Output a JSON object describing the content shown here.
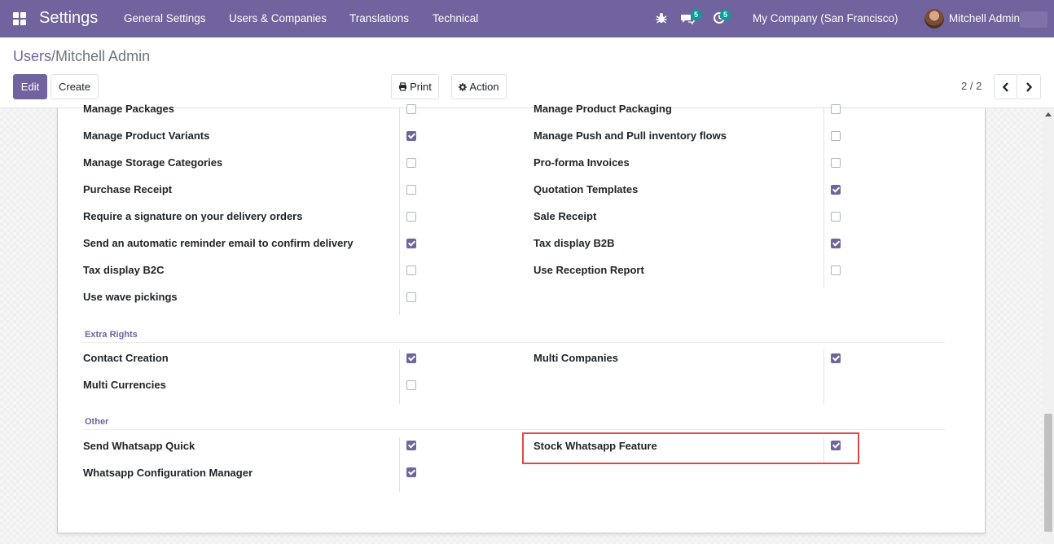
{
  "navbar": {
    "brand": "Settings",
    "menu": [
      "General Settings",
      "Users & Companies",
      "Translations",
      "Technical"
    ],
    "messages_count": "5",
    "activities_count": "5",
    "company": "My Company (San Francisco)",
    "user": "Mitchell Admin"
  },
  "breadcrumb": {
    "parent": "Users",
    "separator": "/",
    "current": "Mitchell Admin"
  },
  "buttons": {
    "edit": "Edit",
    "create": "Create",
    "print": "Print",
    "action": "Action"
  },
  "pager": {
    "value": "2 / 2"
  },
  "sections": {
    "technical_rows": [
      {
        "left": "Manage Packages",
        "left_checked": false,
        "right": "Manage Product Packaging",
        "right_checked": false
      },
      {
        "left": "Manage Product Variants",
        "left_checked": true,
        "right": "Manage Push and Pull inventory flows",
        "right_checked": false
      },
      {
        "left": "Manage Storage Categories",
        "left_checked": false,
        "right": "Pro-forma Invoices",
        "right_checked": false
      },
      {
        "left": "Purchase Receipt",
        "left_checked": false,
        "right": "Quotation Templates",
        "right_checked": true
      },
      {
        "left": "Require a signature on your delivery orders",
        "left_checked": false,
        "right": "Sale Receipt",
        "right_checked": false
      },
      {
        "left": "Send an automatic reminder email to confirm delivery",
        "left_checked": true,
        "right": "Tax display B2B",
        "right_checked": true
      },
      {
        "left": "Tax display B2C",
        "left_checked": false,
        "right": "Use Reception Report",
        "right_checked": false
      },
      {
        "left": "Use wave pickings",
        "left_checked": false
      }
    ],
    "extra_rights": {
      "title": "Extra Rights",
      "rows": [
        {
          "left": "Contact Creation",
          "left_checked": true,
          "right": "Multi Companies",
          "right_checked": true
        },
        {
          "left": "Multi Currencies",
          "left_checked": false
        }
      ]
    },
    "other": {
      "title": "Other",
      "rows": [
        {
          "left": "Send Whatsapp Quick",
          "left_checked": true,
          "right": "Stock Whatsapp Feature",
          "right_checked": true
        },
        {
          "left": "Whatsapp Configuration Manager",
          "left_checked": true
        }
      ]
    }
  }
}
